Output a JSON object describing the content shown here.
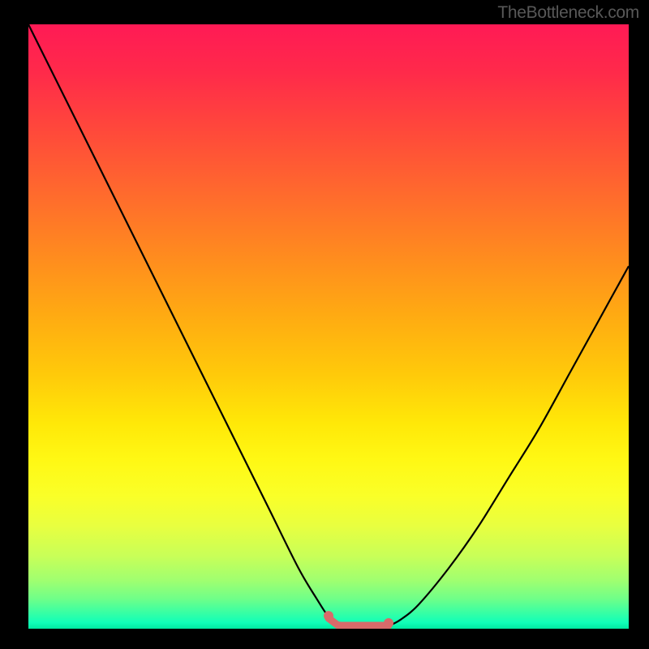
{
  "watermark": "TheBottleneck.com",
  "chart_data": {
    "type": "line",
    "title": "",
    "xlabel": "",
    "ylabel": "",
    "xlim": [
      0,
      100
    ],
    "ylim": [
      0,
      100
    ],
    "x": [
      0,
      5,
      10,
      15,
      20,
      25,
      30,
      35,
      40,
      45,
      48,
      50,
      52,
      55,
      58,
      60,
      62,
      65,
      70,
      75,
      80,
      85,
      90,
      95,
      100
    ],
    "y": [
      100,
      90,
      80,
      70,
      60,
      50,
      40,
      30,
      20,
      10,
      5,
      2,
      0.5,
      0,
      0,
      0.5,
      1.5,
      4,
      10,
      17,
      25,
      33,
      42,
      51,
      60
    ],
    "background_gradient": {
      "top": "#ff1a55",
      "mid": "#ffca0a",
      "bottom": "#00e8a0"
    },
    "marker_region": {
      "x_start": 50,
      "x_end": 60,
      "color": "#d86a6a"
    },
    "curve_color": "#000000"
  }
}
